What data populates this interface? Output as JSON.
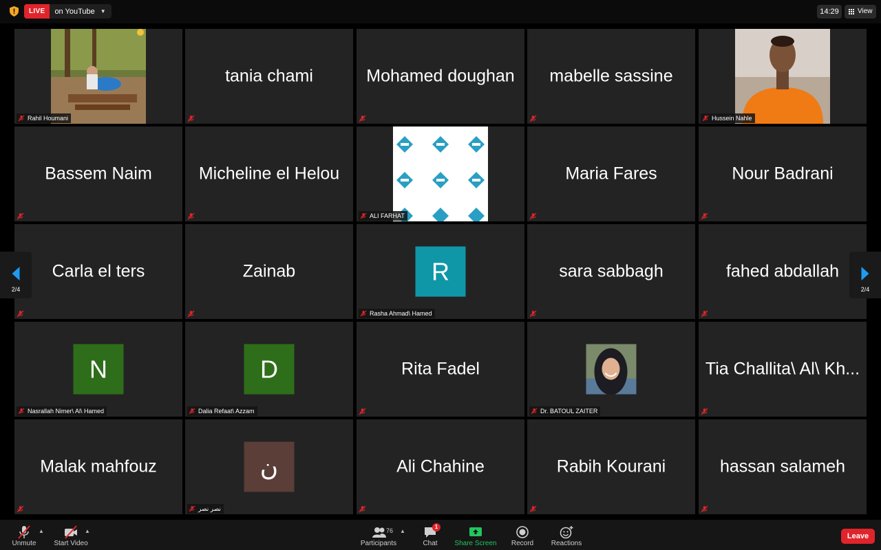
{
  "top": {
    "live_badge": "LIVE",
    "live_text": "on YouTube",
    "clock": "14:29",
    "view_label": "View"
  },
  "pager": {
    "left_page": "2/4",
    "right_page": "2/4"
  },
  "tiles": [
    {
      "display": "",
      "label": "Rahil Houmani"
    },
    {
      "display": "tania chami",
      "label": ""
    },
    {
      "display": "Mohamed doughan",
      "label": ""
    },
    {
      "display": "mabelle sassine",
      "label": ""
    },
    {
      "display": "",
      "label": "Hussein Nahle"
    },
    {
      "display": "Bassem Naim",
      "label": ""
    },
    {
      "display": "Micheline el Helou",
      "label": ""
    },
    {
      "display": "",
      "label": "ALI FARHAT"
    },
    {
      "display": "Maria Fares",
      "label": ""
    },
    {
      "display": "Nour Badrani",
      "label": ""
    },
    {
      "display": "Carla el ters",
      "label": ""
    },
    {
      "display": "Zainab",
      "label": ""
    },
    {
      "display": "R",
      "label": "Rasha Ahmad\\ Hamed"
    },
    {
      "display": "sara sabbagh",
      "label": ""
    },
    {
      "display": "fahed abdallah",
      "label": ""
    },
    {
      "display": "N",
      "label": "Nasrallah Nimer\\ Al\\ Hamed"
    },
    {
      "display": "D",
      "label": "Dalia Refaat\\ Azzam"
    },
    {
      "display": "Rita Fadel",
      "label": ""
    },
    {
      "display": "",
      "label": "Dr. BATOUL ZAITER"
    },
    {
      "display": "Tia Challita\\ Al\\ Kh...",
      "label": ""
    },
    {
      "display": "Malak mahfouz",
      "label": ""
    },
    {
      "display": "ن",
      "label": "نصر نصر"
    },
    {
      "display": "Ali Chahine",
      "label": ""
    },
    {
      "display": "Rabih Kourani",
      "label": ""
    },
    {
      "display": "hassan salameh",
      "label": ""
    }
  ],
  "avatar_colors": {
    "R": "#0f97a8",
    "N": "#2e6e1a",
    "D": "#2e6e1a",
    "arabic": "#5a3e37"
  },
  "toolbar": {
    "unmute": "Unmute",
    "start_video": "Start Video",
    "participants": "Participants",
    "participants_count": "76",
    "chat": "Chat",
    "chat_badge": "1",
    "share_screen": "Share Screen",
    "record": "Record",
    "reactions": "Reactions",
    "leave": "Leave"
  },
  "colors": {
    "live_red": "#e0242b",
    "share_green": "#22c55e",
    "pager_blue": "#1e9bf0"
  }
}
